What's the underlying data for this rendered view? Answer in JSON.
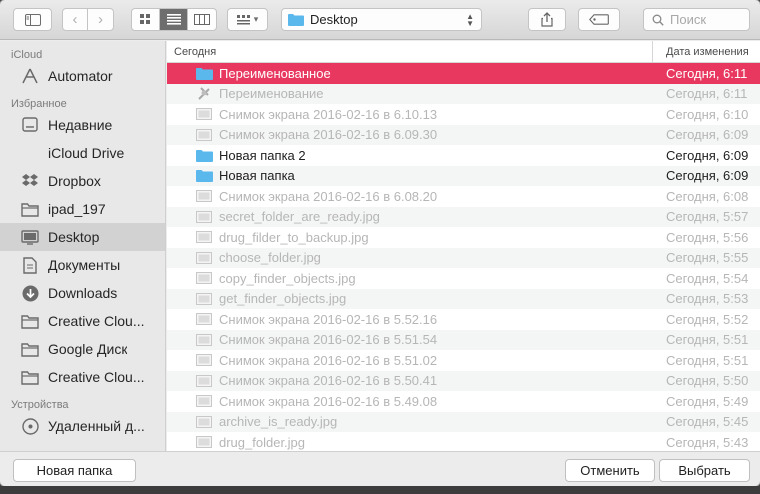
{
  "toolbar": {
    "location": "Desktop",
    "search_placeholder": "Поиск"
  },
  "sidebar": {
    "sections": [
      {
        "title": "iCloud",
        "items": [
          {
            "label": "Automator",
            "icon": "automator-icon"
          }
        ]
      },
      {
        "title": "Избранное",
        "items": [
          {
            "label": "Недавние",
            "icon": "recents-icon"
          },
          {
            "label": "iCloud Drive",
            "icon": "cloud-icon"
          },
          {
            "label": "Dropbox",
            "icon": "dropbox-icon"
          },
          {
            "label": "ipad_197",
            "icon": "folder-icon"
          },
          {
            "label": "Desktop",
            "icon": "desktop-icon",
            "selected": true
          },
          {
            "label": "Документы",
            "icon": "documents-icon"
          },
          {
            "label": "Downloads",
            "icon": "downloads-icon"
          },
          {
            "label": "Creative Clou...",
            "icon": "folder-icon"
          },
          {
            "label": "Google Диск",
            "icon": "folder-icon"
          },
          {
            "label": "Creative Clou...",
            "icon": "folder-icon"
          }
        ]
      },
      {
        "title": "Устройства",
        "items": [
          {
            "label": "Удаленный д...",
            "icon": "disc-icon"
          }
        ]
      }
    ]
  },
  "list": {
    "col_name": "Сегодня",
    "col_date": "Дата изменения",
    "rows": [
      {
        "name": "Переименованное",
        "date": "Сегодня, 6:11",
        "icon": "folder-icon",
        "state": "selected"
      },
      {
        "name": "Переименование",
        "date": "Сегодня, 6:11",
        "icon": "workflow-icon",
        "state": "disabled"
      },
      {
        "name": "Снимок экрана 2016-02-16 в 6.10.13",
        "date": "Сегодня, 6:10",
        "icon": "image-icon",
        "state": "disabled"
      },
      {
        "name": "Снимок экрана 2016-02-16 в 6.09.30",
        "date": "Сегодня, 6:09",
        "icon": "image-icon",
        "state": "disabled"
      },
      {
        "name": "Новая папка 2",
        "date": "Сегодня, 6:09",
        "icon": "folder-icon",
        "state": "enabled"
      },
      {
        "name": "Новая папка",
        "date": "Сегодня, 6:09",
        "icon": "folder-icon",
        "state": "enabled"
      },
      {
        "name": "Снимок экрана 2016-02-16 в 6.08.20",
        "date": "Сегодня, 6:08",
        "icon": "image-icon",
        "state": "disabled"
      },
      {
        "name": "secret_folder_are_ready.jpg",
        "date": "Сегодня, 5:57",
        "icon": "image-icon",
        "state": "disabled"
      },
      {
        "name": "drug_filder_to_backup.jpg",
        "date": "Сегодня, 5:56",
        "icon": "image-icon",
        "state": "disabled"
      },
      {
        "name": "choose_folder.jpg",
        "date": "Сегодня, 5:55",
        "icon": "image-icon",
        "state": "disabled"
      },
      {
        "name": "copy_finder_objects.jpg",
        "date": "Сегодня, 5:54",
        "icon": "image-icon",
        "state": "disabled"
      },
      {
        "name": "get_finder_objects.jpg",
        "date": "Сегодня, 5:53",
        "icon": "image-icon",
        "state": "disabled"
      },
      {
        "name": "Снимок экрана 2016-02-16 в 5.52.16",
        "date": "Сегодня, 5:52",
        "icon": "image-icon",
        "state": "disabled"
      },
      {
        "name": "Снимок экрана 2016-02-16 в 5.51.54",
        "date": "Сегодня, 5:51",
        "icon": "image-icon",
        "state": "disabled"
      },
      {
        "name": "Снимок экрана 2016-02-16 в 5.51.02",
        "date": "Сегодня, 5:51",
        "icon": "image-icon",
        "state": "disabled"
      },
      {
        "name": "Снимок экрана 2016-02-16 в 5.50.41",
        "date": "Сегодня, 5:50",
        "icon": "image-icon",
        "state": "disabled"
      },
      {
        "name": "Снимок экрана 2016-02-16 в 5.49.08",
        "date": "Сегодня, 5:49",
        "icon": "image-icon",
        "state": "disabled"
      },
      {
        "name": "archive_is_ready.jpg",
        "date": "Сегодня, 5:45",
        "icon": "image-icon",
        "state": "disabled"
      },
      {
        "name": "drug_folder.jpg",
        "date": "Сегодня, 5:43",
        "icon": "image-icon",
        "state": "disabled"
      }
    ]
  },
  "footer": {
    "new_folder": "Новая папка",
    "cancel": "Отменить",
    "choose": "Выбрать"
  },
  "colors": {
    "selection": "#e8385f",
    "folder": "#5ab8ec"
  }
}
